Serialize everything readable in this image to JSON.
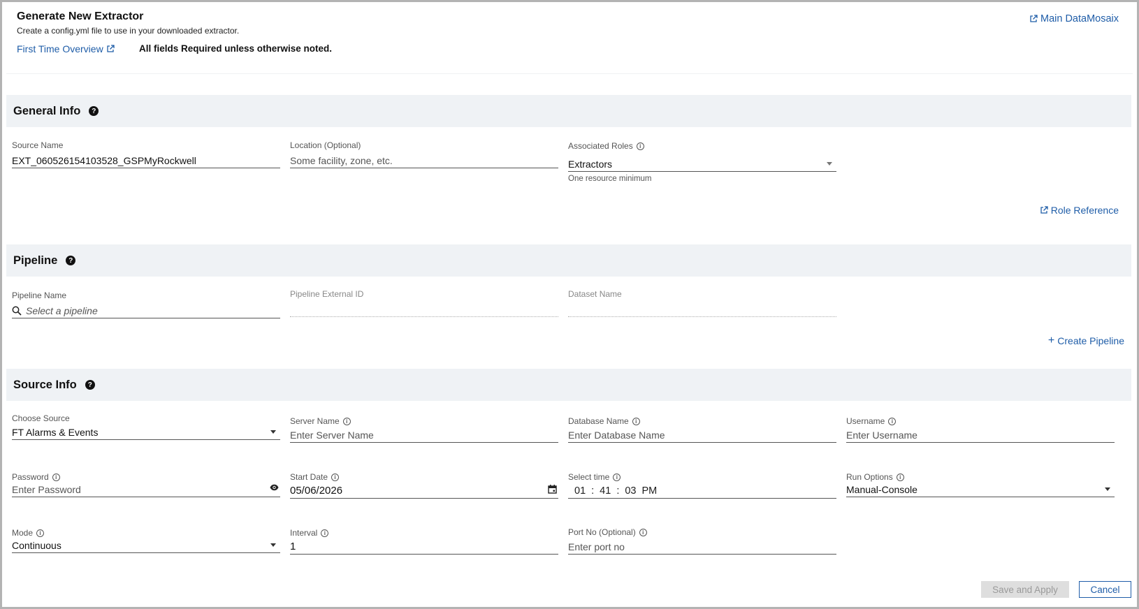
{
  "header": {
    "title": "Generate New Extractor",
    "subtitle": "Create a config.yml file to use in your downloaded extractor.",
    "first_time_link": "First Time Overview",
    "required_note": "All fields Required unless otherwise noted.",
    "main_link": "Main DataMosaix"
  },
  "general_info": {
    "title": "General Info",
    "source_name": {
      "label": "Source Name",
      "value": "EXT_060526154103528_GSPMyRockwell"
    },
    "location": {
      "label": "Location (Optional)",
      "placeholder": "Some facility, zone, etc."
    },
    "associated_roles": {
      "label": "Associated Roles",
      "value": "Extractors",
      "helper": "One resource minimum"
    },
    "role_reference_link": "Role Reference"
  },
  "pipeline": {
    "title": "Pipeline",
    "pipeline_name": {
      "label": "Pipeline Name",
      "placeholder": "Select a pipeline"
    },
    "pipeline_external_id": {
      "label": "Pipeline External ID"
    },
    "dataset_name": {
      "label": "Dataset Name"
    },
    "create_pipeline_link": "Create Pipeline"
  },
  "source_info": {
    "title": "Source Info",
    "choose_source": {
      "label": "Choose Source",
      "value": "FT Alarms & Events"
    },
    "server_name": {
      "label": "Server Name",
      "placeholder": "Enter Server Name"
    },
    "database_name": {
      "label": "Database Name",
      "placeholder": "Enter Database Name"
    },
    "username": {
      "label": "Username",
      "placeholder": "Enter Username"
    },
    "password": {
      "label": "Password",
      "placeholder": "Enter Password"
    },
    "start_date": {
      "label": "Start Date",
      "value": "05/06/2026"
    },
    "select_time": {
      "label": "Select time",
      "hour": "01",
      "minute": "41",
      "second": "03",
      "ampm": "PM",
      "sep": ":"
    },
    "run_options": {
      "label": "Run Options",
      "value": "Manual-Console"
    },
    "mode": {
      "label": "Mode",
      "value": "Continuous"
    },
    "interval": {
      "label": "Interval",
      "value": "1"
    },
    "port_no": {
      "label": "Port No (Optional)",
      "placeholder": "Enter port no"
    }
  },
  "actions": {
    "save_label": "Save and Apply",
    "cancel_label": "Cancel"
  },
  "colors": {
    "link": "#1f5da8",
    "section_bg": "#eff2f5",
    "disabled_bg": "#dedede"
  }
}
